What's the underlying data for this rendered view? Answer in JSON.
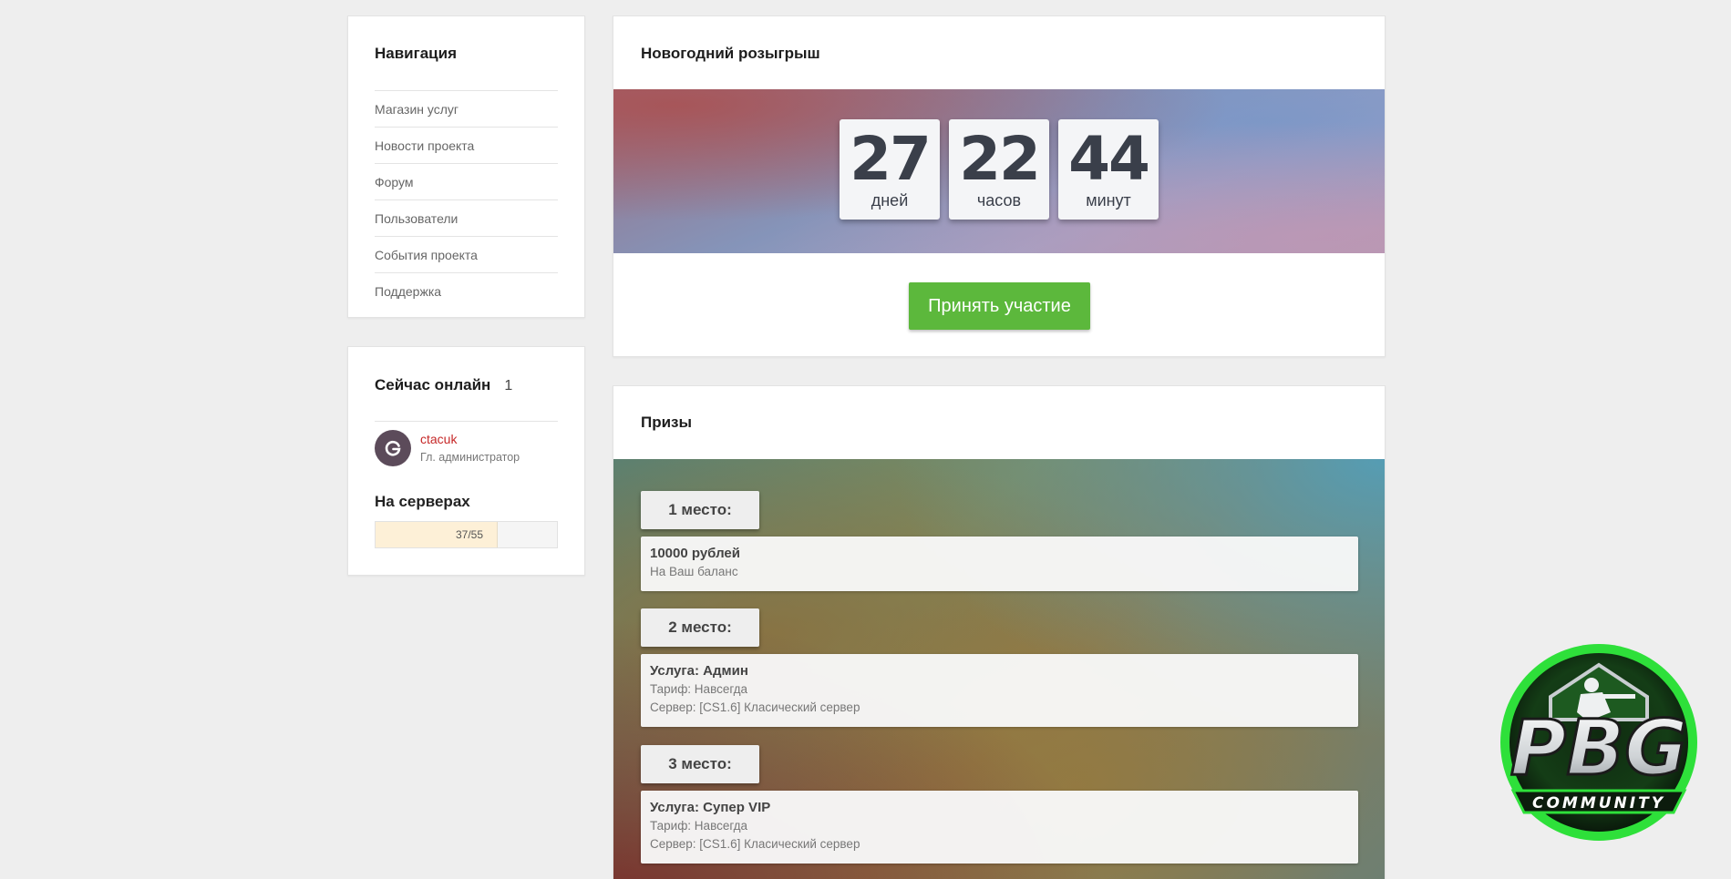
{
  "navigation": {
    "title": "Навигация",
    "items": [
      {
        "label": "Магазин услуг"
      },
      {
        "label": "Новости проекта"
      },
      {
        "label": "Форум"
      },
      {
        "label": "Пользователи"
      },
      {
        "label": "События проекта"
      },
      {
        "label": "Поддержка"
      }
    ]
  },
  "online": {
    "title": "Сейчас онлайн",
    "count": "1",
    "user": {
      "name": "ctacuk",
      "role": "Гл. администратор",
      "avatar_letter": "G",
      "name_color": "#c62828"
    },
    "servers_title": "На серверах",
    "servers_label": "37/55",
    "servers_fraction": 0.6727
  },
  "giveaway": {
    "title": "Новогодний розыгрыш",
    "countdown": [
      {
        "value": "27",
        "unit": "дней"
      },
      {
        "value": "22",
        "unit": "часов"
      },
      {
        "value": "44",
        "unit": "минут"
      }
    ],
    "join_label": "Принять участие",
    "join_color": "#5cb83c"
  },
  "prizes": {
    "title": "Призы",
    "places": [
      {
        "place": "1 место:",
        "title": "10000 рублей",
        "lines": [
          "На Ваш баланс"
        ]
      },
      {
        "place": "2 место:",
        "title": "Услуга: Админ",
        "lines": [
          "Тариф: Навсегда",
          "Сервер: [CS1.6] Класический сервер"
        ]
      },
      {
        "place": "3 место:",
        "title": "Услуга: Супер VIP",
        "lines": [
          "Тариф: Навсегда",
          "Сервер: [CS1.6] Класический сервер"
        ]
      }
    ]
  },
  "logo": {
    "text_main": "PBG",
    "text_sub": "COMMUNITY",
    "accent": "#37d63a"
  }
}
